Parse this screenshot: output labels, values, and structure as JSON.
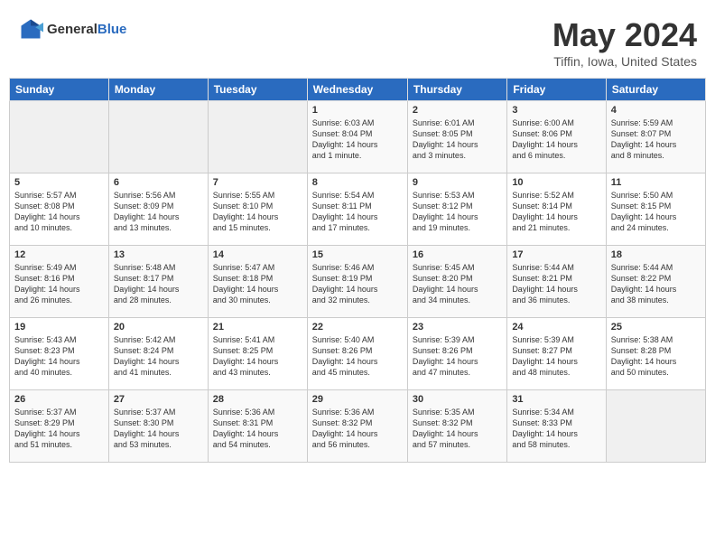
{
  "header": {
    "logo": {
      "text1": "General",
      "text2": "Blue"
    },
    "title": "May 2024",
    "subtitle": "Tiffin, Iowa, United States"
  },
  "weekdays": [
    "Sunday",
    "Monday",
    "Tuesday",
    "Wednesday",
    "Thursday",
    "Friday",
    "Saturday"
  ],
  "weeks": [
    [
      {
        "day": "",
        "content": ""
      },
      {
        "day": "",
        "content": ""
      },
      {
        "day": "",
        "content": ""
      },
      {
        "day": "1",
        "content": "Sunrise: 6:03 AM\nSunset: 8:04 PM\nDaylight: 14 hours\nand 1 minute."
      },
      {
        "day": "2",
        "content": "Sunrise: 6:01 AM\nSunset: 8:05 PM\nDaylight: 14 hours\nand 3 minutes."
      },
      {
        "day": "3",
        "content": "Sunrise: 6:00 AM\nSunset: 8:06 PM\nDaylight: 14 hours\nand 6 minutes."
      },
      {
        "day": "4",
        "content": "Sunrise: 5:59 AM\nSunset: 8:07 PM\nDaylight: 14 hours\nand 8 minutes."
      }
    ],
    [
      {
        "day": "5",
        "content": "Sunrise: 5:57 AM\nSunset: 8:08 PM\nDaylight: 14 hours\nand 10 minutes."
      },
      {
        "day": "6",
        "content": "Sunrise: 5:56 AM\nSunset: 8:09 PM\nDaylight: 14 hours\nand 13 minutes."
      },
      {
        "day": "7",
        "content": "Sunrise: 5:55 AM\nSunset: 8:10 PM\nDaylight: 14 hours\nand 15 minutes."
      },
      {
        "day": "8",
        "content": "Sunrise: 5:54 AM\nSunset: 8:11 PM\nDaylight: 14 hours\nand 17 minutes."
      },
      {
        "day": "9",
        "content": "Sunrise: 5:53 AM\nSunset: 8:12 PM\nDaylight: 14 hours\nand 19 minutes."
      },
      {
        "day": "10",
        "content": "Sunrise: 5:52 AM\nSunset: 8:14 PM\nDaylight: 14 hours\nand 21 minutes."
      },
      {
        "day": "11",
        "content": "Sunrise: 5:50 AM\nSunset: 8:15 PM\nDaylight: 14 hours\nand 24 minutes."
      }
    ],
    [
      {
        "day": "12",
        "content": "Sunrise: 5:49 AM\nSunset: 8:16 PM\nDaylight: 14 hours\nand 26 minutes."
      },
      {
        "day": "13",
        "content": "Sunrise: 5:48 AM\nSunset: 8:17 PM\nDaylight: 14 hours\nand 28 minutes."
      },
      {
        "day": "14",
        "content": "Sunrise: 5:47 AM\nSunset: 8:18 PM\nDaylight: 14 hours\nand 30 minutes."
      },
      {
        "day": "15",
        "content": "Sunrise: 5:46 AM\nSunset: 8:19 PM\nDaylight: 14 hours\nand 32 minutes."
      },
      {
        "day": "16",
        "content": "Sunrise: 5:45 AM\nSunset: 8:20 PM\nDaylight: 14 hours\nand 34 minutes."
      },
      {
        "day": "17",
        "content": "Sunrise: 5:44 AM\nSunset: 8:21 PM\nDaylight: 14 hours\nand 36 minutes."
      },
      {
        "day": "18",
        "content": "Sunrise: 5:44 AM\nSunset: 8:22 PM\nDaylight: 14 hours\nand 38 minutes."
      }
    ],
    [
      {
        "day": "19",
        "content": "Sunrise: 5:43 AM\nSunset: 8:23 PM\nDaylight: 14 hours\nand 40 minutes."
      },
      {
        "day": "20",
        "content": "Sunrise: 5:42 AM\nSunset: 8:24 PM\nDaylight: 14 hours\nand 41 minutes."
      },
      {
        "day": "21",
        "content": "Sunrise: 5:41 AM\nSunset: 8:25 PM\nDaylight: 14 hours\nand 43 minutes."
      },
      {
        "day": "22",
        "content": "Sunrise: 5:40 AM\nSunset: 8:26 PM\nDaylight: 14 hours\nand 45 minutes."
      },
      {
        "day": "23",
        "content": "Sunrise: 5:39 AM\nSunset: 8:26 PM\nDaylight: 14 hours\nand 47 minutes."
      },
      {
        "day": "24",
        "content": "Sunrise: 5:39 AM\nSunset: 8:27 PM\nDaylight: 14 hours\nand 48 minutes."
      },
      {
        "day": "25",
        "content": "Sunrise: 5:38 AM\nSunset: 8:28 PM\nDaylight: 14 hours\nand 50 minutes."
      }
    ],
    [
      {
        "day": "26",
        "content": "Sunrise: 5:37 AM\nSunset: 8:29 PM\nDaylight: 14 hours\nand 51 minutes."
      },
      {
        "day": "27",
        "content": "Sunrise: 5:37 AM\nSunset: 8:30 PM\nDaylight: 14 hours\nand 53 minutes."
      },
      {
        "day": "28",
        "content": "Sunrise: 5:36 AM\nSunset: 8:31 PM\nDaylight: 14 hours\nand 54 minutes."
      },
      {
        "day": "29",
        "content": "Sunrise: 5:36 AM\nSunset: 8:32 PM\nDaylight: 14 hours\nand 56 minutes."
      },
      {
        "day": "30",
        "content": "Sunrise: 5:35 AM\nSunset: 8:32 PM\nDaylight: 14 hours\nand 57 minutes."
      },
      {
        "day": "31",
        "content": "Sunrise: 5:34 AM\nSunset: 8:33 PM\nDaylight: 14 hours\nand 58 minutes."
      },
      {
        "day": "",
        "content": ""
      }
    ]
  ]
}
